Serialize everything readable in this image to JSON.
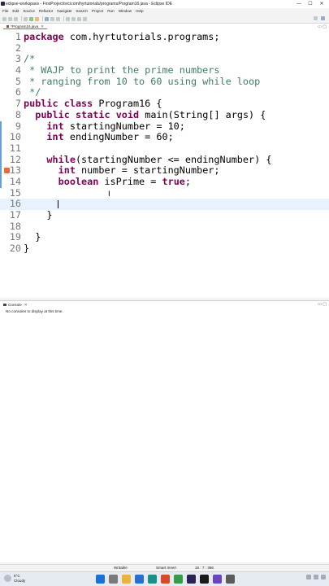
{
  "window": {
    "title": "eclipse-workspace - FirstProject/src/com/hyrtutorials/programs/Program16.java - Eclipse IDE",
    "controls": [
      "—",
      "☐",
      "✕"
    ]
  },
  "menubar": [
    "File",
    "Edit",
    "Source",
    "Refactor",
    "Navigate",
    "Search",
    "Project",
    "Run",
    "Window",
    "Help"
  ],
  "editor": {
    "tab_label": "*Program16.java",
    "tab_close": "✕",
    "view_controls": "▭ ▢",
    "lines": [
      {
        "n": "1",
        "segments": [
          {
            "t": "package",
            "c": "kw"
          },
          {
            "t": " com.hyrtutorials.programs;",
            "c": ""
          }
        ]
      },
      {
        "n": "2",
        "segments": []
      },
      {
        "n": "3",
        "segments": [
          {
            "t": "/*",
            "c": "cm"
          }
        ]
      },
      {
        "n": "4",
        "segments": [
          {
            "t": " * WAJP to print the prime numbers",
            "c": "cm"
          }
        ]
      },
      {
        "n": "5",
        "segments": [
          {
            "t": " * ranging from 10 to 60 using while loop",
            "c": "cm"
          }
        ]
      },
      {
        "n": "6",
        "segments": [
          {
            "t": " */",
            "c": "cm"
          }
        ]
      },
      {
        "n": "7",
        "segments": [
          {
            "t": "public",
            "c": "kw"
          },
          {
            "t": " ",
            "c": ""
          },
          {
            "t": "class",
            "c": "kw"
          },
          {
            "t": " Program16 {",
            "c": ""
          }
        ]
      },
      {
        "n": "8",
        "segments": [
          {
            "t": "  ",
            "c": ""
          },
          {
            "t": "public",
            "c": "kw"
          },
          {
            "t": " ",
            "c": ""
          },
          {
            "t": "static",
            "c": "kw"
          },
          {
            "t": " ",
            "c": ""
          },
          {
            "t": "void",
            "c": "kw"
          },
          {
            "t": " main(String[] args) {",
            "c": ""
          }
        ]
      },
      {
        "n": "9",
        "segments": [
          {
            "t": "    ",
            "c": ""
          },
          {
            "t": "int",
            "c": "kw"
          },
          {
            "t": " startingNumber = 10;",
            "c": ""
          }
        ]
      },
      {
        "n": "10",
        "segments": [
          {
            "t": "    ",
            "c": ""
          },
          {
            "t": "int",
            "c": "kw"
          },
          {
            "t": " endingNumber = 60;",
            "c": ""
          }
        ]
      },
      {
        "n": "11",
        "segments": []
      },
      {
        "n": "12",
        "segments": [
          {
            "t": "    ",
            "c": ""
          },
          {
            "t": "while",
            "c": "kw"
          },
          {
            "t": "(startingNumber <= endingNumber) {",
            "c": ""
          }
        ]
      },
      {
        "n": "13",
        "segments": [
          {
            "t": "      ",
            "c": ""
          },
          {
            "t": "int",
            "c": "kw"
          },
          {
            "t": " number = startingNumber;",
            "c": ""
          }
        ]
      },
      {
        "n": "14",
        "segments": [
          {
            "t": "      ",
            "c": ""
          },
          {
            "t": "boolean",
            "c": "kw"
          },
          {
            "t": " isPrime = ",
            "c": ""
          },
          {
            "t": "true",
            "c": "kw"
          },
          {
            "t": ";",
            "c": ""
          }
        ]
      },
      {
        "n": "15",
        "segments": []
      },
      {
        "n": "16",
        "segments": []
      },
      {
        "n": "17",
        "segments": [
          {
            "t": "    }",
            "c": ""
          }
        ]
      },
      {
        "n": "18",
        "segments": []
      },
      {
        "n": "19",
        "segments": [
          {
            "t": "  }",
            "c": ""
          }
        ]
      },
      {
        "n": "20",
        "segments": [
          {
            "t": "}",
            "c": ""
          }
        ]
      }
    ],
    "cursor_line": "16",
    "error_line": "13"
  },
  "console": {
    "tab_label": "Console",
    "tab_close": "✕",
    "view_controls": "▭ ▢",
    "message": "No consoles to display at this time."
  },
  "status": {
    "mode": "Writable",
    "insert": "Smart Insert",
    "position": "16 : 7 : 366"
  },
  "taskbar": {
    "temp": "6°C",
    "condition": "Cloudy",
    "app_colors": [
      "#1f6fd6",
      "#7a7a7a",
      "#e8b43a",
      "#2a6fcf",
      "#1d8e8a",
      "#d84a2b",
      "#3a9a4c",
      "#2c2255",
      "#1a1a1a",
      "#6a46b8",
      "#5b5b5b"
    ]
  }
}
